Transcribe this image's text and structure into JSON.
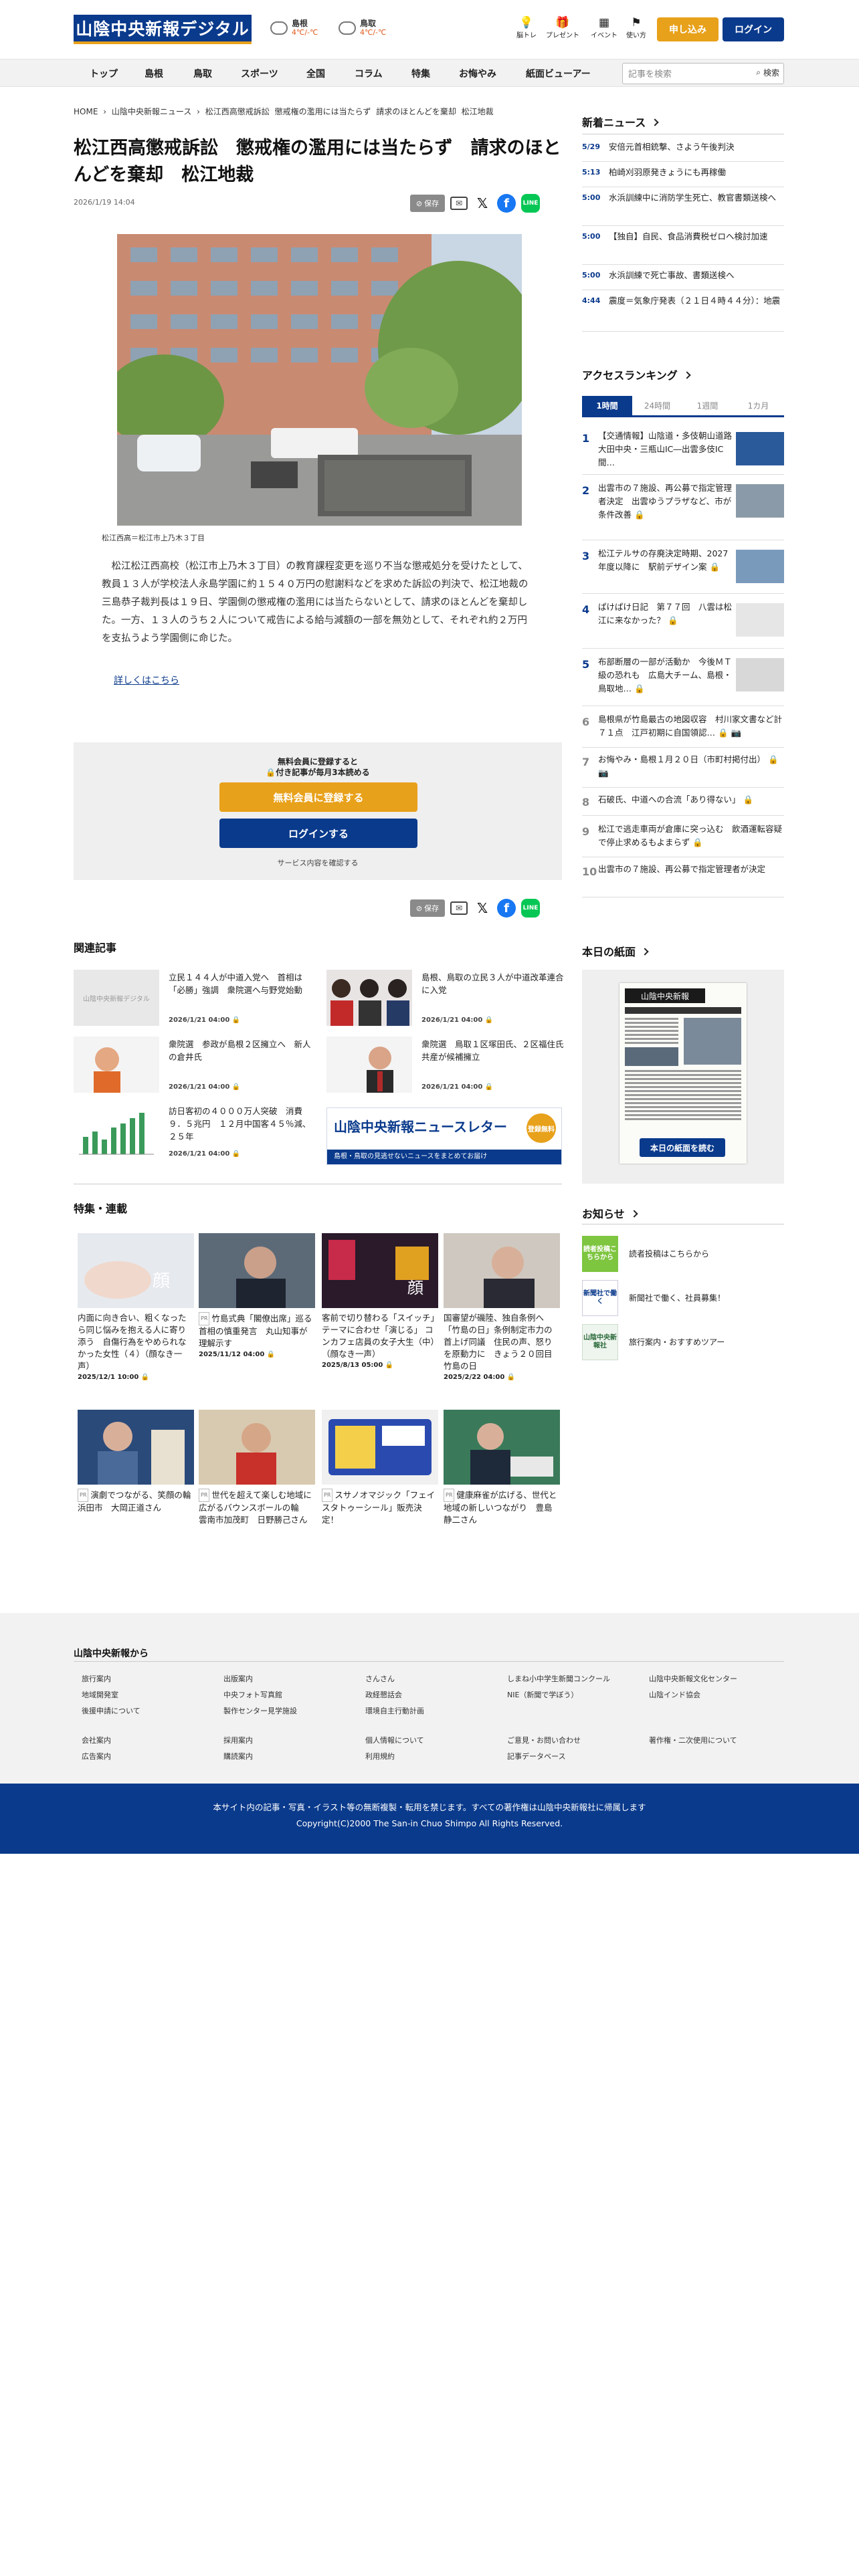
{
  "header": {
    "logo": "山陰中央新報デジタル",
    "weather": [
      {
        "name": "島根",
        "temp": "4℃/-℃"
      },
      {
        "name": "鳥取",
        "temp": "4℃/-℃"
      }
    ],
    "icons": [
      {
        "label": "脳トレ",
        "icon": "bulb-icon",
        "glyph": "💡"
      },
      {
        "label": "プレゼント",
        "icon": "gift-icon",
        "glyph": "🎁"
      },
      {
        "label": "イベント",
        "icon": "calendar-icon",
        "glyph": "▦"
      },
      {
        "label": "使い方",
        "icon": "guide-icon",
        "glyph": "⚑"
      }
    ],
    "signup": "申し込み",
    "login": "ログイン"
  },
  "nav": {
    "items": [
      "トップ",
      "島根",
      "鳥取",
      "スポーツ",
      "全国",
      "コラム",
      "特集",
      "お悔やみ",
      "紙面ビューアー"
    ],
    "search_placeholder": "記事を検索",
    "search_button": "検索"
  },
  "breadcrumb": [
    "HOME",
    "›",
    "山陰中央新報ニュース",
    "›",
    "松江西高懲戒訴訟",
    "懲戒権の濫用には当たらず",
    "請求のほとんどを棄却",
    "松江地裁"
  ],
  "article": {
    "title": "松江西高懲戒訴訟　懲戒権の濫用には当たらず　請求のほとんどを棄却　松江地裁",
    "date": "2026/1/19 14:04",
    "save": "保存",
    "caption": "松江西高＝松江市上乃木３丁目",
    "body": "松江松江西高校（松江市上乃木３丁目）の教育課程変更を巡り不当な懲戒処分を受けたとして、教員１３人が学校法人永島学園に約１５４０万円の慰謝料などを求めた訴訟の判決で、松江地裁の三島恭子裁判長は１９日、学園側の懲戒権の濫用には当たらないとして、請求のほとんどを棄却した。一方、１３人のうち２人について戒告による給与減額の一部を無効として、それぞれ約２万円を支払うよう学園側に命じた。",
    "more": "詳しくはこちら"
  },
  "paywall": {
    "line1": "無料会員に登録すると",
    "line2": "🔒付き記事が毎月3本読める",
    "register": "無料会員に登録する",
    "login": "ログインする",
    "service": "サービス内容を確認する"
  },
  "related": {
    "heading": "関連記事",
    "items": [
      {
        "title": "立民１４４人が中道入党へ　首相は「必勝」強調　衆院選へ与野党始動",
        "date": "2026/1/21 04:00 🔒"
      },
      {
        "title": "島根、鳥取の立民３人が中道改革連合に入党",
        "date": "2026/1/21 04:00 🔒"
      },
      {
        "title": "衆院選　参政が島根２区擁立へ　新人の倉井氏",
        "date": "2026/1/21 04:00 🔒"
      },
      {
        "title": "衆院選　鳥取１区塚田氏、２区福住氏　共産が候補擁立",
        "date": "2026/1/21 04:00 🔒"
      },
      {
        "title": "訪日客初の４０００万人突破　消費９．５兆円　１２月中国客４５％減、２５年",
        "date": "2026/1/21 04:00 🔒"
      }
    ],
    "newsletter_title": "山陰中央新報ニュースレター",
    "newsletter_badge": "登録無料",
    "newsletter_sub": "島根・鳥取の見逃せないニュースをまとめてお届け"
  },
  "features": {
    "heading": "特集・連載",
    "items": [
      {
        "tag": "",
        "title": "内面に向き合い、粗くなったら同じ悩みを抱える人に寄り添う　自傷行為をやめられなかった女性（４）（顔なき一声）",
        "date": "2025/12/1 10:00 🔒"
      },
      {
        "tag": "PR",
        "title": "竹島式典「閣僚出席」巡る首相の慎重発言　丸山知事が理解示す",
        "date": "2025/11/12 04:00 🔒"
      },
      {
        "tag": "",
        "title": "客前で切り替わる「スイッチ」テーマに合わせ「演じる」 コンカフェ店員の女子大生（中）（顔なき一声）",
        "date": "2025/8/13 05:00 🔒"
      },
      {
        "tag": "",
        "title": "国審望が磯陸、独自条例へ「竹島の日」条例制定市力の首上げ同議　住民の声、怒りを原動力に　きょう２０回目竹島の日",
        "date": "2025/2/22 04:00 🔒"
      },
      {
        "tag": "PR",
        "title": "演劇でつながる、笑顔の輪　浜田市　大岡正道さん",
        "date": ""
      },
      {
        "tag": "PR",
        "title": "世代を超えて楽しむ地域に広がるバウンスボールの輪　雲南市加茂町　日野勝己さん",
        "date": ""
      },
      {
        "tag": "PR",
        "title": "スサノオマジック「フェイスタトゥーシール」販売決定！",
        "date": ""
      },
      {
        "tag": "PR",
        "title": "健康麻雀が広げる、世代と地域の新しいつながり　豊島静二さん",
        "date": ""
      }
    ]
  },
  "latest": {
    "heading": "新着ニュース",
    "items": [
      {
        "time": "5/29",
        "title": "安倍元首相銃撃、さよう午後判決"
      },
      {
        "time": "5:13",
        "title": "柏崎刈羽原発きょうにも再稼働"
      },
      {
        "time": "5:00",
        "title": "水浜訓練中に消防学生死亡、教官書類送検へ"
      },
      {
        "time": "5:00",
        "title": "【独自】自民、食品消費税ゼロへ検討加速"
      },
      {
        "time": "5:00",
        "title": "水浜訓練で死亡事故、書類送検へ"
      },
      {
        "time": "4:44",
        "title": "震度＝気象庁発表（２１日４時４４分）：地震"
      }
    ]
  },
  "ranking": {
    "heading": "アクセスランキング",
    "tabs": [
      "1時間",
      "24時間",
      "1週間",
      "1カ月"
    ],
    "items": [
      {
        "n": "1",
        "title": "【交通情報】山陰道・多伎朝山道路　大田中央・三瓶山IC―出雲多伎IC間…"
      },
      {
        "n": "2",
        "title": "出雲市の７施設、再公募で指定管理者決定　出雲ゆうプラザなど、市が条件改善 🔒"
      },
      {
        "n": "3",
        "title": "松江テルサの存廃決定時期、2027年度以降に　駅前デザイン案 🔒"
      },
      {
        "n": "4",
        "title": "ぱけぱけ日記　第７７回　八雲は松江に来なかった？ 🔒"
      },
      {
        "n": "5",
        "title": "布部断層の一部が活動か　今後ＭＴ級の恐れも　広島大チーム、島根・鳥取地… 🔒"
      },
      {
        "n": "6",
        "title": "島根県が竹島最古の地図収容　村川家文書など計７１点　江戸初期に自国領認… 🔒 📷"
      },
      {
        "n": "7",
        "title": "お悔やみ・島根１月２０日（市町村掲付出） 🔒 📷"
      },
      {
        "n": "8",
        "title": "石破氏、中道への合流「あり得ない」 🔒"
      },
      {
        "n": "9",
        "title": "松江で逃走車両が倉庫に突っ込む　飲酒運転容疑で停止求めるもよまらず 🔒"
      },
      {
        "n": "10",
        "title": "出雲市の７施設、再公募で指定管理者が決定"
      }
    ]
  },
  "paper": {
    "heading": "本日の紙面",
    "button": "本日の紙面を読む",
    "masthead": "山陰中央新報"
  },
  "notices": {
    "heading": "お知らせ",
    "items": [
      {
        "badge": "読者投稿こちらから",
        "title": "読者投稿はこちらから"
      },
      {
        "badge": "新聞社で働く",
        "title": "新聞社で働く、社員募集！"
      },
      {
        "badge": "山陰中央新報社",
        "title": "旅行案内・おすすめツアー"
      }
    ]
  },
  "footer": {
    "heading": "山陰中央新報から",
    "links": [
      [
        "旅行案内",
        "出版案内",
        "さんさん",
        "しまね小中学生新聞コンクール",
        "山陰中央新報文化センター"
      ],
      [
        "地域開発室",
        "中央フォト写真館",
        "政経懇話会",
        "NIE（新聞で学ぼう）",
        "山陰インド協会"
      ],
      [
        "後援申請について",
        "製作センター見学施設",
        "環境自主行動計画",
        "",
        ""
      ],
      [
        "会社案内",
        "採用案内",
        "個人情報について",
        "ご意見・お問い合わせ",
        "著作権・二次使用について"
      ],
      [
        "広告案内",
        "購読案内",
        "利用規約",
        "記事データベース",
        ""
      ]
    ],
    "notice": "本サイト内の記事・写真・イラスト等の無断複製・転用を禁じます。すべての著作権は山陰中央新報社に帰属します",
    "copyright": "Copyright(C)2000 The San-in Chuo Shimpo All Rights Reserved."
  },
  "colors": {
    "brand": "#0a3a8c",
    "accent": "#e8a11a"
  }
}
